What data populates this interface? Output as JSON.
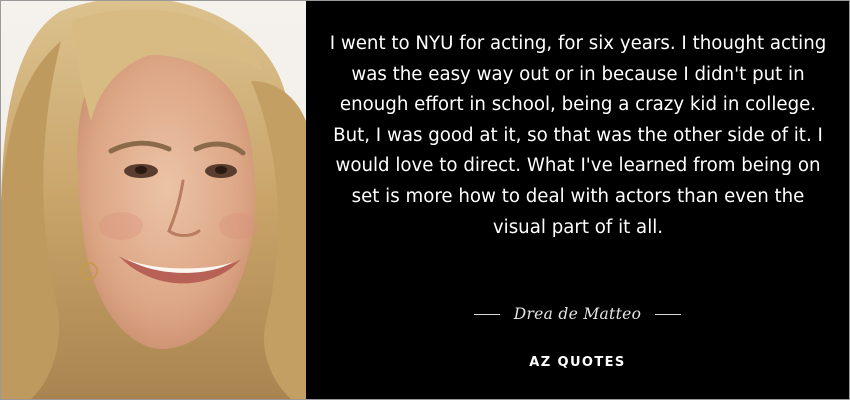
{
  "quote": {
    "text": "I went to NYU for acting, for six years. I thought acting was the easy way out or in because I didn't put in enough effort in school, being a crazy kid in college. But, I was good at it, so that was the other side of it. I would love to direct. What I've learned from being on set is more how to deal with actors than even the visual part of it all.",
    "author": "Drea de Matteo"
  },
  "brand": {
    "logo_text": "AZ QUOTES"
  },
  "colors": {
    "panel_bg": "#000000",
    "text": "#ffffff",
    "hair": "#c9a56a",
    "skin": "#e1b091"
  }
}
